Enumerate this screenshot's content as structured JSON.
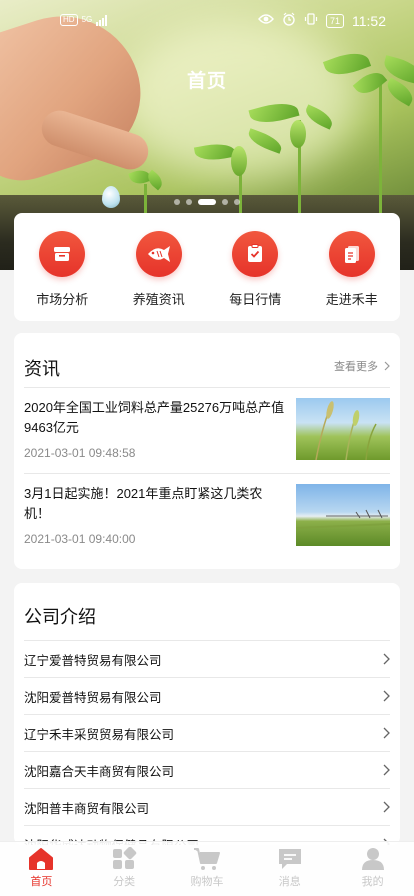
{
  "status_bar": {
    "left": "HD",
    "network": "5G",
    "battery": "71",
    "time": "11:52"
  },
  "header": {
    "title": "首页"
  },
  "banner": {
    "slides": 5,
    "active_slide": 3
  },
  "categories": [
    {
      "label": "市场分析",
      "icon": "store-icon"
    },
    {
      "label": "养殖资讯",
      "icon": "fish-icon"
    },
    {
      "label": "每日行情",
      "icon": "checklist-icon"
    },
    {
      "label": "走进禾丰",
      "icon": "document-icon"
    }
  ],
  "news": {
    "title": "资讯",
    "more_label": "查看更多",
    "items": [
      {
        "title": "2020年全国工业饲料总产量25276万吨总产值9463亿元",
        "time": "2021-03-01 09:48:58"
      },
      {
        "title": "3月1日起实施！2021年重点盯紧这几类农机！",
        "time": "2021-03-01 09:40:00"
      }
    ]
  },
  "company": {
    "title": "公司介绍",
    "items": [
      "辽宁爱普特贸易有限公司",
      "沈阳爱普特贸易有限公司",
      "辽宁禾丰采贸贸易有限公司",
      "沈阳嘉合天丰商贸有限公司",
      "沈阳普丰商贸有限公司",
      "沈阳华威达动物保健品有限公司"
    ]
  },
  "tabbar": [
    {
      "label": "首页",
      "icon": "home-icon",
      "active": true
    },
    {
      "label": "分类",
      "icon": "category-icon",
      "active": false
    },
    {
      "label": "购物车",
      "icon": "cart-icon",
      "active": false
    },
    {
      "label": "消息",
      "icon": "message-icon",
      "active": false
    },
    {
      "label": "我的",
      "icon": "user-icon",
      "active": false
    }
  ],
  "colors": {
    "accent": "#e6332a",
    "tab_inactive": "#c8c8c8"
  }
}
